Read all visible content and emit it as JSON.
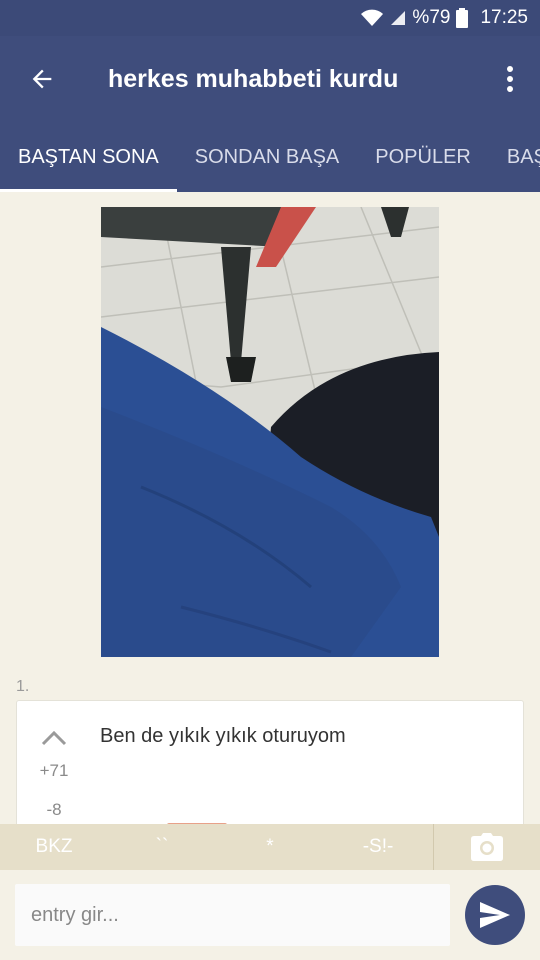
{
  "status_bar": {
    "battery": "%79",
    "time": "17:25"
  },
  "app_bar": {
    "title": "herkes muhabbeti kurdu"
  },
  "tabs": [
    {
      "label": "BAŞTAN SONA",
      "active": true
    },
    {
      "label": "SONDAN BAŞA",
      "active": false
    },
    {
      "label": "POPÜLER",
      "active": false
    },
    {
      "label": "BAŞ",
      "active": false
    }
  ],
  "entry": {
    "number": "1.",
    "text": "Ben de yıkık yıkık oturuyom",
    "upvotes": "+71",
    "downvotes": "-8"
  },
  "format_bar": {
    "bkz": "BKZ",
    "backtick": "``",
    "star": "*",
    "spoiler": "-S!-"
  },
  "composer": {
    "placeholder": "entry gir..."
  },
  "colors": {
    "primary": "#3f4d7c",
    "background": "#f4f1e6",
    "toolbar": "#e6dfc9"
  }
}
